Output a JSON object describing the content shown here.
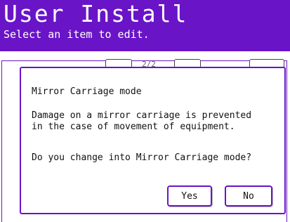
{
  "header": {
    "title": "User Install",
    "subtitle": "Select an item to edit."
  },
  "background": {
    "page_indicator": "2/2"
  },
  "dialog": {
    "title": "Mirror Carriage mode",
    "line1": "Damage on a mirror carriage is prevented",
    "line2": "in the case of movement of equipment.",
    "question": "Do you change into Mirror Carriage mode?",
    "yes_label": "Yes",
    "no_label": "No"
  },
  "colors": {
    "accent": "#6a14c8",
    "background": "#ffffff",
    "text": "#111111"
  }
}
